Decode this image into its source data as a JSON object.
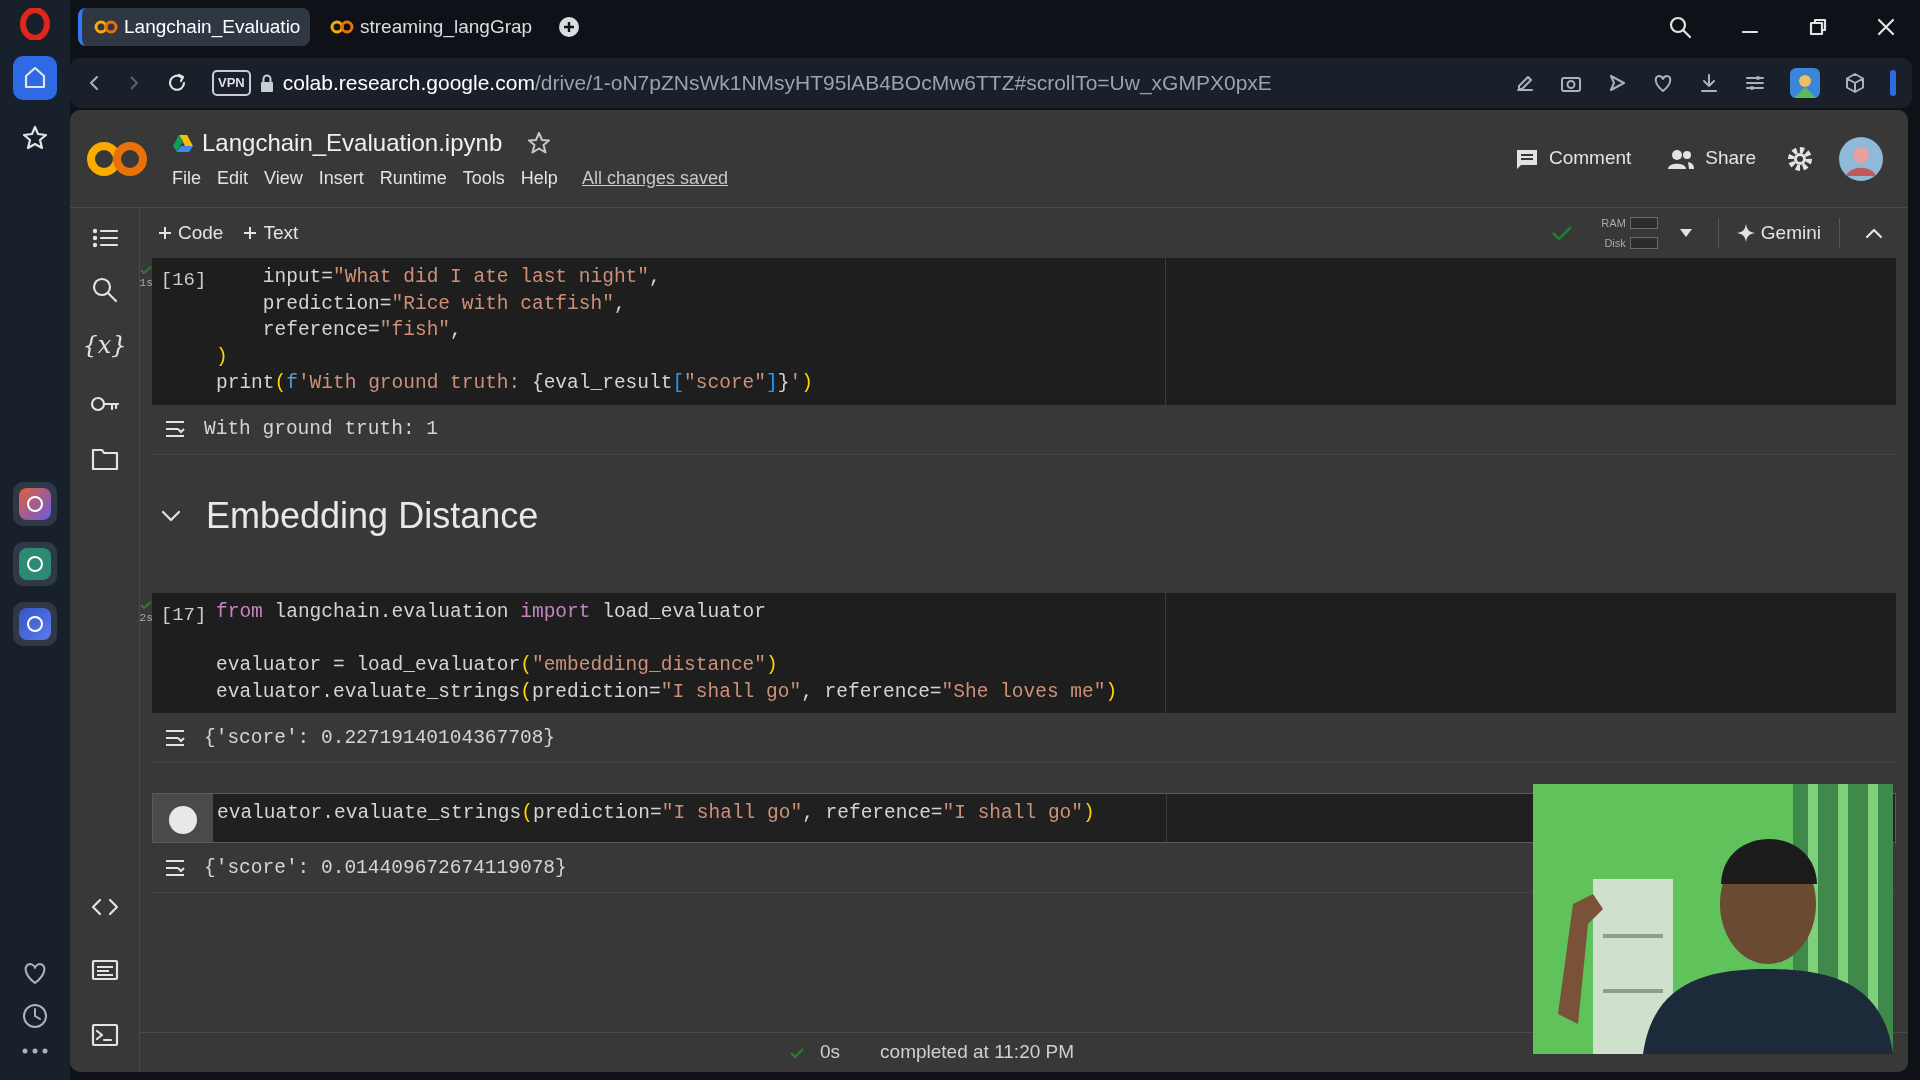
{
  "browser": {
    "tabs": [
      {
        "label": "Langchain_Evaluatio",
        "selected": true
      },
      {
        "label": "streaming_langGrap",
        "selected": false
      }
    ],
    "vpn": "VPN",
    "url_host": "colab.research.google.com",
    "url_path": "/drive/1-oN7pZNsWk1NMsyHT95lAB4BOcMw6TTZ#scrollTo=Uw_xGMPX0pxE"
  },
  "sidebar": {
    "items": [
      {
        "kind": "home",
        "selected": true
      },
      {
        "kind": "star",
        "selected": false
      }
    ]
  },
  "notebook": {
    "title": "Langchain_Evaluation.ipynb",
    "starred": false,
    "menu": [
      "File",
      "Edit",
      "View",
      "Insert",
      "Runtime",
      "Tools",
      "Help"
    ],
    "save_status": "All changes saved",
    "comment": "Comment",
    "share": "Share"
  },
  "toolbar": {
    "add_code": "Code",
    "add_text": "Text",
    "connected": true,
    "ram": "RAM",
    "disk": "Disk",
    "gemini": "Gemini"
  },
  "rail": {
    "variables": "{x}"
  },
  "cells": [
    {
      "kind": "code",
      "count": "[16]",
      "time": "1s",
      "ok": true,
      "focused": false,
      "lines": [
        {
          "tokens": [
            {
              "kind": "plain",
              "t": "    input="
            },
            {
              "kind": "string",
              "t": "\"What did I ate last night\""
            },
            {
              "kind": "plain",
              "t": ","
            }
          ]
        },
        {
          "tokens": [
            {
              "kind": "plain",
              "t": "    prediction="
            },
            {
              "kind": "string",
              "t": "\"Rice with catfish\""
            },
            {
              "kind": "plain",
              "t": ","
            }
          ]
        },
        {
          "tokens": [
            {
              "kind": "plain",
              "t": "    reference="
            },
            {
              "kind": "string",
              "t": "\"fish\""
            },
            {
              "kind": "plain",
              "t": ","
            }
          ]
        },
        {
          "tokens": [
            {
              "kind": "paren",
              "t": ")"
            }
          ]
        },
        {
          "tokens": [
            {
              "kind": "plain",
              "t": "print"
            },
            {
              "kind": "paren",
              "t": "("
            },
            {
              "kind": "prefix",
              "t": "f"
            },
            {
              "kind": "string",
              "t": "'With ground truth: "
            },
            {
              "kind": "plain",
              "t": "{eval_result"
            },
            {
              "kind": "bracket",
              "t": "["
            },
            {
              "kind": "string",
              "t": "\"score\""
            },
            {
              "kind": "bracket",
              "t": "]"
            },
            {
              "kind": "plain",
              "t": "}"
            },
            {
              "kind": "string",
              "t": "'"
            },
            {
              "kind": "paren",
              "t": ")"
            }
          ]
        }
      ],
      "output": "With ground truth: 1"
    },
    {
      "kind": "heading",
      "text": "Embedding Distance",
      "expanded": true
    },
    {
      "kind": "code",
      "count": "[17]",
      "time": "2s",
      "ok": true,
      "focused": false,
      "lines": [
        {
          "tokens": [
            {
              "kind": "keyword",
              "t": "from"
            },
            {
              "kind": "plain",
              "t": " langchain.evaluation "
            },
            {
              "kind": "keyword",
              "t": "import"
            },
            {
              "kind": "plain",
              "t": " load_evaluator"
            }
          ]
        },
        {
          "after_blank": true,
          "tokens": [
            {
              "kind": "plain",
              "t": "evaluator = load_evaluator"
            },
            {
              "kind": "paren",
              "t": "("
            },
            {
              "kind": "string",
              "t": "\"embedding_distance\""
            },
            {
              "kind": "paren",
              "t": ")"
            }
          ]
        },
        {
          "tokens": [
            {
              "kind": "plain",
              "t": "evaluator.evaluate_strings"
            },
            {
              "kind": "paren",
              "t": "("
            },
            {
              "kind": "plain",
              "t": "prediction="
            },
            {
              "kind": "string",
              "t": "\"I shall go\""
            },
            {
              "kind": "plain",
              "t": ", reference="
            },
            {
              "kind": "string",
              "t": "\"She loves me\""
            },
            {
              "kind": "paren",
              "t": ")"
            }
          ]
        }
      ],
      "output": "{'score': 0.22719140104367708}"
    },
    {
      "kind": "code",
      "focused": true,
      "lines": [
        {
          "tokens": [
            {
              "kind": "plain",
              "t": "evaluator.evaluate_strings"
            },
            {
              "kind": "paren",
              "t": "("
            },
            {
              "kind": "plain",
              "t": "prediction="
            },
            {
              "kind": "string",
              "t": "\"I shall go\""
            },
            {
              "kind": "plain",
              "t": ", reference="
            },
            {
              "kind": "string",
              "t": "\"I shall go\""
            },
            {
              "kind": "paren",
              "t": ")"
            }
          ]
        }
      ],
      "output": "{'score': 0.014409672674119078}"
    }
  ],
  "status_bar": {
    "ok": true,
    "duration": "0s",
    "message": "completed at 11:20 PM"
  }
}
